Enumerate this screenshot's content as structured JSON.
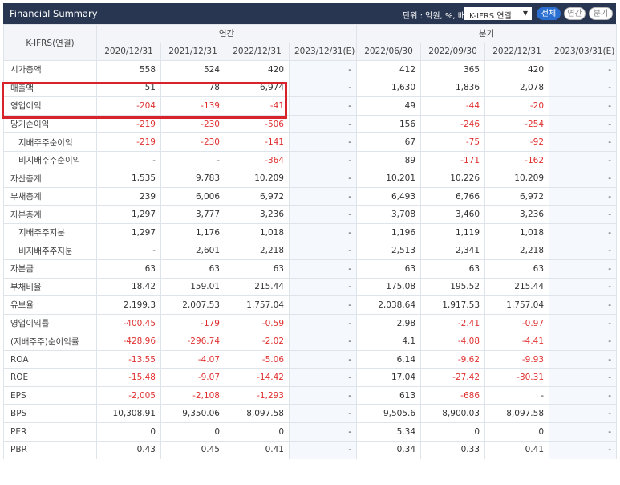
{
  "header": {
    "title": "Financial Summary",
    "unit_label": "단위 : 억원, %, 배",
    "standard_select": "K-IFRS 연결",
    "btn_all": "전체",
    "btn_annual": "연간",
    "btn_quarter": "분기"
  },
  "table": {
    "corner_label": "K-IFRS(연결)",
    "group_annual": "연간",
    "group_quarter": "분기",
    "periods": [
      "2020/12/31",
      "2021/12/31",
      "2022/12/31",
      "2023/12/31(E)",
      "2022/06/30",
      "2022/09/30",
      "2022/12/31",
      "2023/03/31(E)"
    ],
    "rows": [
      {
        "label": "시가총액",
        "sub": false,
        "values": [
          "558",
          "524",
          "420",
          "-",
          "412",
          "365",
          "420",
          "-"
        ]
      },
      {
        "label": "매출액",
        "sub": false,
        "values": [
          "51",
          "78",
          "6,974",
          "-",
          "1,630",
          "1,836",
          "2,078",
          "-"
        ]
      },
      {
        "label": "영업이익",
        "sub": false,
        "values": [
          "-204",
          "-139",
          "-41",
          "-",
          "49",
          "-44",
          "-20",
          "-"
        ]
      },
      {
        "label": "당기순이익",
        "sub": false,
        "values": [
          "-219",
          "-230",
          "-506",
          "-",
          "156",
          "-246",
          "-254",
          "-"
        ]
      },
      {
        "label": "지배주주순이익",
        "sub": true,
        "values": [
          "-219",
          "-230",
          "-141",
          "-",
          "67",
          "-75",
          "-92",
          "-"
        ]
      },
      {
        "label": "비지배주주순이익",
        "sub": true,
        "values": [
          "-",
          "-",
          "-364",
          "-",
          "89",
          "-171",
          "-162",
          "-"
        ]
      },
      {
        "label": "자산총계",
        "sub": false,
        "values": [
          "1,535",
          "9,783",
          "10,209",
          "-",
          "10,201",
          "10,226",
          "10,209",
          "-"
        ]
      },
      {
        "label": "부채총계",
        "sub": false,
        "values": [
          "239",
          "6,006",
          "6,972",
          "-",
          "6,493",
          "6,766",
          "6,972",
          "-"
        ]
      },
      {
        "label": "자본총계",
        "sub": false,
        "values": [
          "1,297",
          "3,777",
          "3,236",
          "-",
          "3,708",
          "3,460",
          "3,236",
          "-"
        ]
      },
      {
        "label": "지배주주지분",
        "sub": true,
        "values": [
          "1,297",
          "1,176",
          "1,018",
          "-",
          "1,196",
          "1,119",
          "1,018",
          "-"
        ]
      },
      {
        "label": "비지배주주지분",
        "sub": true,
        "values": [
          "-",
          "2,601",
          "2,218",
          "-",
          "2,513",
          "2,341",
          "2,218",
          "-"
        ]
      },
      {
        "label": "자본금",
        "sub": false,
        "values": [
          "63",
          "63",
          "63",
          "-",
          "63",
          "63",
          "63",
          "-"
        ]
      },
      {
        "label": "부채비율",
        "sub": false,
        "values": [
          "18.42",
          "159.01",
          "215.44",
          "-",
          "175.08",
          "195.52",
          "215.44",
          "-"
        ]
      },
      {
        "label": "유보율",
        "sub": false,
        "values": [
          "2,199.3",
          "2,007.53",
          "1,757.04",
          "-",
          "2,038.64",
          "1,917.53",
          "1,757.04",
          "-"
        ]
      },
      {
        "label": "영업이익률",
        "sub": false,
        "values": [
          "-400.45",
          "-179",
          "-0.59",
          "-",
          "2.98",
          "-2.41",
          "-0.97",
          "-"
        ]
      },
      {
        "label": "(지배주주)순이익률",
        "sub": false,
        "values": [
          "-428.96",
          "-296.74",
          "-2.02",
          "-",
          "4.1",
          "-4.08",
          "-4.41",
          "-"
        ]
      },
      {
        "label": "ROA",
        "sub": false,
        "values": [
          "-13.55",
          "-4.07",
          "-5.06",
          "-",
          "6.14",
          "-9.62",
          "-9.93",
          "-"
        ]
      },
      {
        "label": "ROE",
        "sub": false,
        "values": [
          "-15.48",
          "-9.07",
          "-14.42",
          "-",
          "17.04",
          "-27.42",
          "-30.31",
          "-"
        ]
      },
      {
        "label": "EPS",
        "sub": false,
        "values": [
          "-2,005",
          "-2,108",
          "-1,293",
          "-",
          "613",
          "-686",
          "-",
          "-"
        ]
      },
      {
        "label": "BPS",
        "sub": false,
        "values": [
          "10,308.91",
          "9,350.06",
          "8,097.58",
          "-",
          "9,505.6",
          "8,900.03",
          "8,097.58",
          "-"
        ]
      },
      {
        "label": "PER",
        "sub": false,
        "values": [
          "0",
          "0",
          "0",
          "-",
          "5.34",
          "0",
          "0",
          "-"
        ]
      },
      {
        "label": "PBR",
        "sub": false,
        "values": [
          "0.43",
          "0.45",
          "0.41",
          "-",
          "0.34",
          "0.33",
          "0.41",
          "-"
        ]
      }
    ]
  },
  "colors": {
    "header_bg": "#283651",
    "negative": "#e03030",
    "highlight_box": "#d8232a",
    "active_button": "#2b6fd1"
  }
}
